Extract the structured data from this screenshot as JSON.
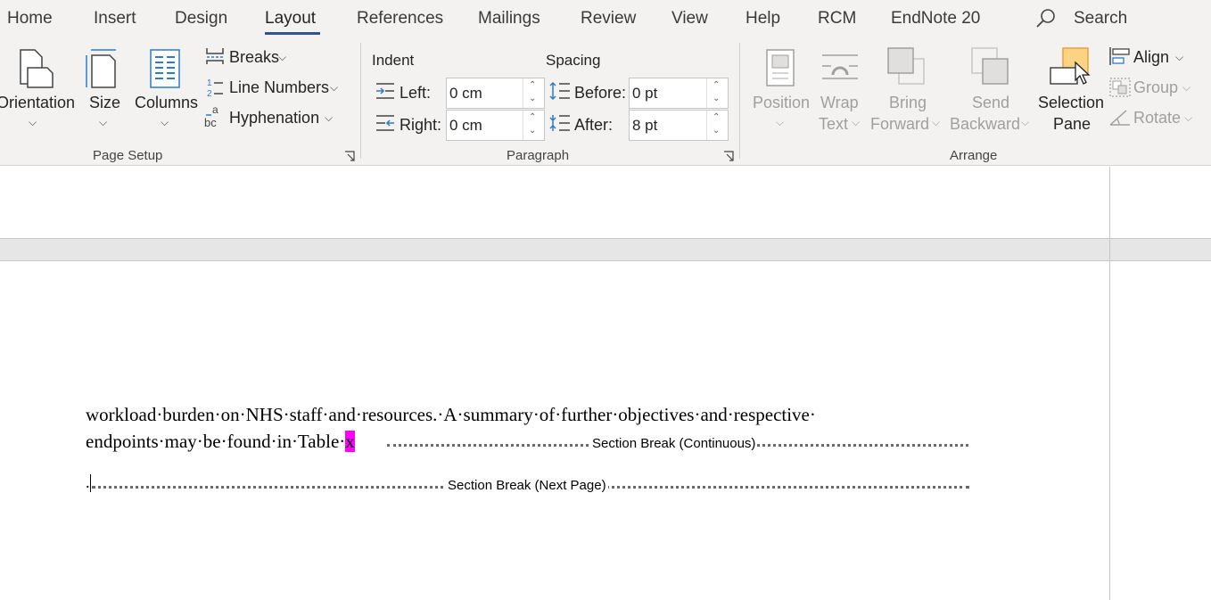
{
  "tabs": [
    {
      "label": "Home"
    },
    {
      "label": "Insert"
    },
    {
      "label": "Design"
    },
    {
      "label": "Layout"
    },
    {
      "label": "References"
    },
    {
      "label": "Mailings"
    },
    {
      "label": "Review"
    },
    {
      "label": "View"
    },
    {
      "label": "Help"
    },
    {
      "label": "RCM"
    },
    {
      "label": "EndNote 20"
    }
  ],
  "active_tab": "Layout",
  "search": {
    "label": "Search"
  },
  "ribbon": {
    "page_setup": {
      "orientation": "Orientation",
      "size": "Size",
      "columns": "Columns",
      "breaks": "Breaks",
      "line_numbers": "Line Numbers",
      "hyphenation": "Hyphenation",
      "group_label": "Page Setup"
    },
    "paragraph": {
      "indent_title": "Indent",
      "spacing_title": "Spacing",
      "left_label": "Left:",
      "right_label": "Right:",
      "before_label": "Before:",
      "after_label": "After:",
      "left_value": "0 cm",
      "right_value": "0 cm",
      "before_value": "0 pt",
      "after_value": "8 pt",
      "group_label": "Paragraph"
    },
    "arrange": {
      "position": "Position",
      "wrap_text_1": "Wrap",
      "wrap_text_2": "Text",
      "bring_forward_1": "Bring",
      "bring_forward_2": "Forward",
      "send_backward_1": "Send",
      "send_backward_2": "Backward",
      "selection_pane_1": "Selection",
      "selection_pane_2": "Pane",
      "align": "Align",
      "group": "Group",
      "rotate": "Rotate",
      "group_label": "Arrange"
    }
  },
  "document": {
    "line1": "workload·burden·on·NHS·staff·and·resources.·A·summary·of·further·objectives·and·respective·",
    "line2_text": "endpoints·may·be·found·in·Table·",
    "line2_highlight": "x",
    "section_break_continuous": "Section Break (Continuous)",
    "section_break_next_page": "Section Break (Next Page)",
    "paragraph_mark": "."
  },
  "colors": {
    "accent": "#2b579a",
    "highlight": "#ff00ff",
    "ribbon_bg": "#f3f2f1"
  }
}
